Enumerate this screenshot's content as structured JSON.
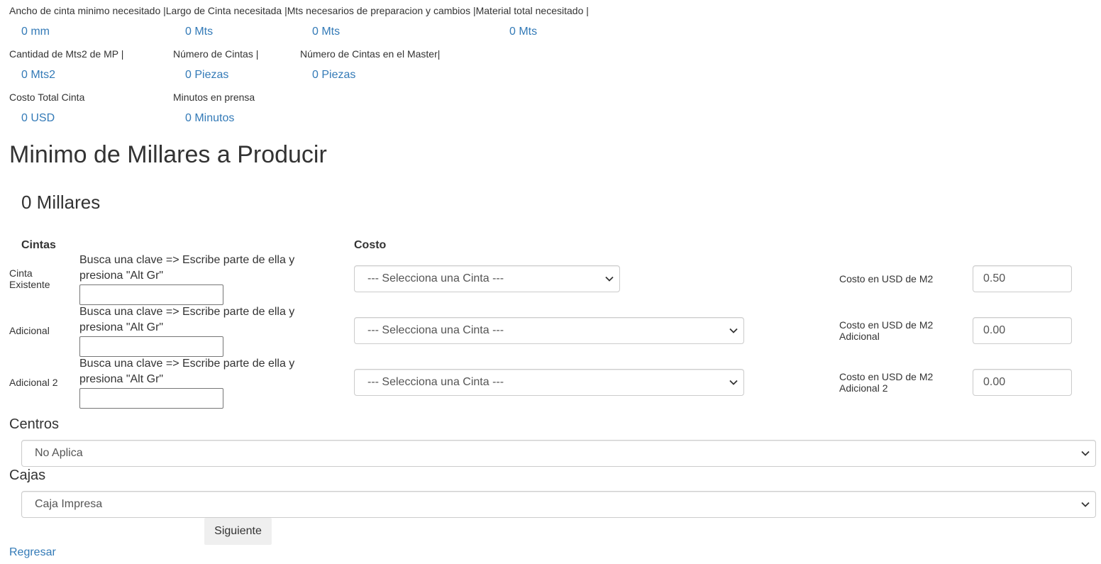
{
  "summary": {
    "row1_header": "Ancho de cinta minimo necesitado |Largo de Cinta necesitada |Mts necesarios de preparacion y cambios |Material total necesitado |",
    "row1_values": [
      "0 mm",
      "0 Mts",
      "0 Mts",
      "0 Mts"
    ],
    "row2_labels": [
      "Cantidad de Mts2 de MP |",
      "Número de Cintas |",
      "Número de Cintas en el Master|"
    ],
    "row2_values": [
      "0 Mts2",
      "0 Piezas",
      "0 Piezas"
    ],
    "row3_labels": [
      "Costo Total Cinta",
      "Minutos en prensa"
    ],
    "row3_values": [
      "0 USD",
      "0 Minutos"
    ]
  },
  "min_millares": {
    "title": "Minimo de Millares a Producir",
    "value": "0 Millares"
  },
  "tape_section": {
    "col_cintas": "Cintas",
    "col_costo": "Costo",
    "rows": [
      {
        "label": "Cinta Existente",
        "hint": "Busca una clave => Escribe parte de ella y presiona \"Alt Gr\"",
        "search_value": "",
        "select_value": "--- Selecciona una Cinta ---",
        "cost_label": "Costo en USD de M2",
        "cost_value": "0.50"
      },
      {
        "label": "Adicional",
        "hint": "Busca una clave => Escribe parte de ella y presiona \"Alt Gr\"",
        "search_value": "",
        "select_value": "--- Selecciona una Cinta ---",
        "cost_label": "Costo en USD de M2 Adicional",
        "cost_value": "0.00"
      },
      {
        "label": "Adicional 2",
        "hint": "Busca una clave => Escribe parte de ella y presiona \"Alt Gr\"",
        "search_value": "",
        "select_value": "--- Selecciona una Cinta ---",
        "cost_label": "Costo en USD de M2 Adicional 2",
        "cost_value": "0.00"
      }
    ]
  },
  "centros": {
    "label": "Centros",
    "value": "No Aplica"
  },
  "cajas": {
    "label": "Cajas",
    "value": "Caja Impresa"
  },
  "actions": {
    "next_label": "Siguiente",
    "back_label": "Regresar"
  },
  "colors": {
    "link": "#337ab7",
    "text": "#333333",
    "border": "#cccccc",
    "button_bg": "#efefef"
  },
  "icons": {
    "select_arrow": "chevron-down-icon"
  }
}
